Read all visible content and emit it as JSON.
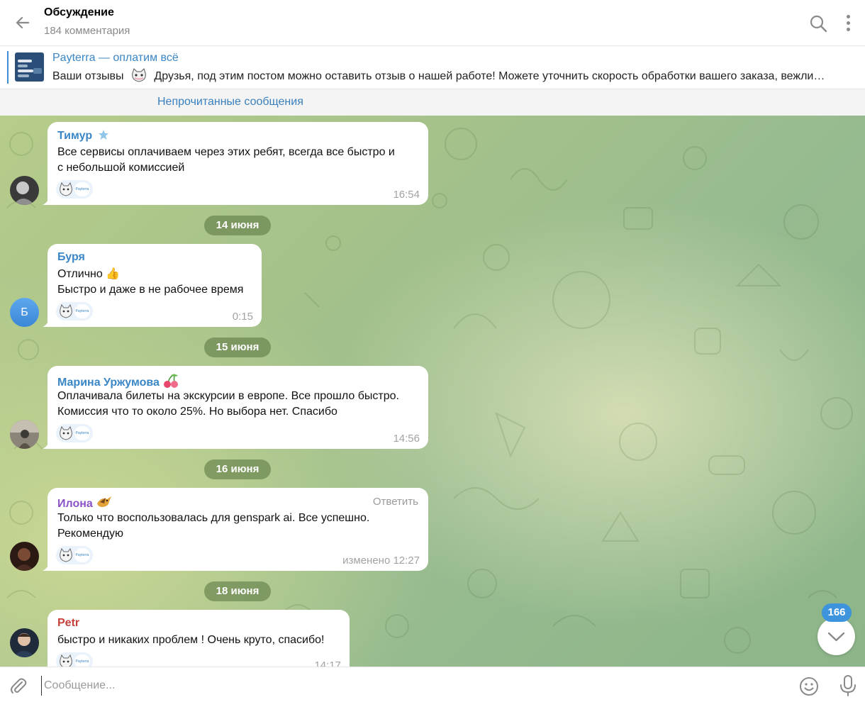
{
  "header": {
    "title": "Обсуждение",
    "subtitle": "184 комментария",
    "icons": [
      "back-arrow-icon",
      "search-icon",
      "more-vertical-icon"
    ]
  },
  "pinned": {
    "title": "Payterra — оплатим всё",
    "text_before": "Ваши отзывы",
    "text_after": "Друзья, под этим постом можно оставить отзыв о нашей работе! Можете уточнить скорость обработки вашего заказа, вежли…"
  },
  "unread_label": "Непрочитанные сообщения",
  "messages": [
    {
      "author": "Тимур",
      "author_color": "#3a86c6",
      "badge": "star",
      "lines": [
        "Все сервисы оплачиваем через этих ребят, всегда все быстро и",
        "с небольшой комиссией"
      ],
      "time": "16:54"
    },
    {
      "author": "Буря",
      "author_color": "#3a86c6",
      "avatar_letter": "Б",
      "lines": [
        "Отлично 👍",
        "Быстро и даже в не рабочее время"
      ],
      "time": "0:15"
    },
    {
      "author": "Марина Уржумова",
      "author_color": "#3a86c6",
      "badge": "cherries",
      "lines": [
        "Оплачивала билеты на экскурсии в европе. Все прошло быстро.",
        "Комиссия что то около 25%. Но выбора нет. Спасибо"
      ],
      "time": "14:56"
    },
    {
      "author": "Илона",
      "author_color": "#8b52c7",
      "badge": "bird",
      "reply_label": "Ответить",
      "lines": [
        "Только что воспользовалась для genspark ai. Все успешно.",
        "Рекомендую"
      ],
      "time": "изменено 12:27"
    },
    {
      "author": "Petr",
      "author_color": "#c7403a",
      "lines": [
        "быстро и никаких проблем ! Очень круто, спасибо!"
      ],
      "time": "14:17"
    }
  ],
  "reaction_logo_text": "Payterra",
  "dates": [
    "14 июня",
    "15 июня",
    "16 июня",
    "18 июня"
  ],
  "scroll_badge": "166",
  "composer": {
    "placeholder": "Сообщение...",
    "icons": [
      "paperclip-icon",
      "emoji-icon",
      "microphone-icon"
    ]
  },
  "colors": {
    "accent": "#3a86c6",
    "date_pill": "#6f8c55",
    "badge": "#3d94dc"
  }
}
